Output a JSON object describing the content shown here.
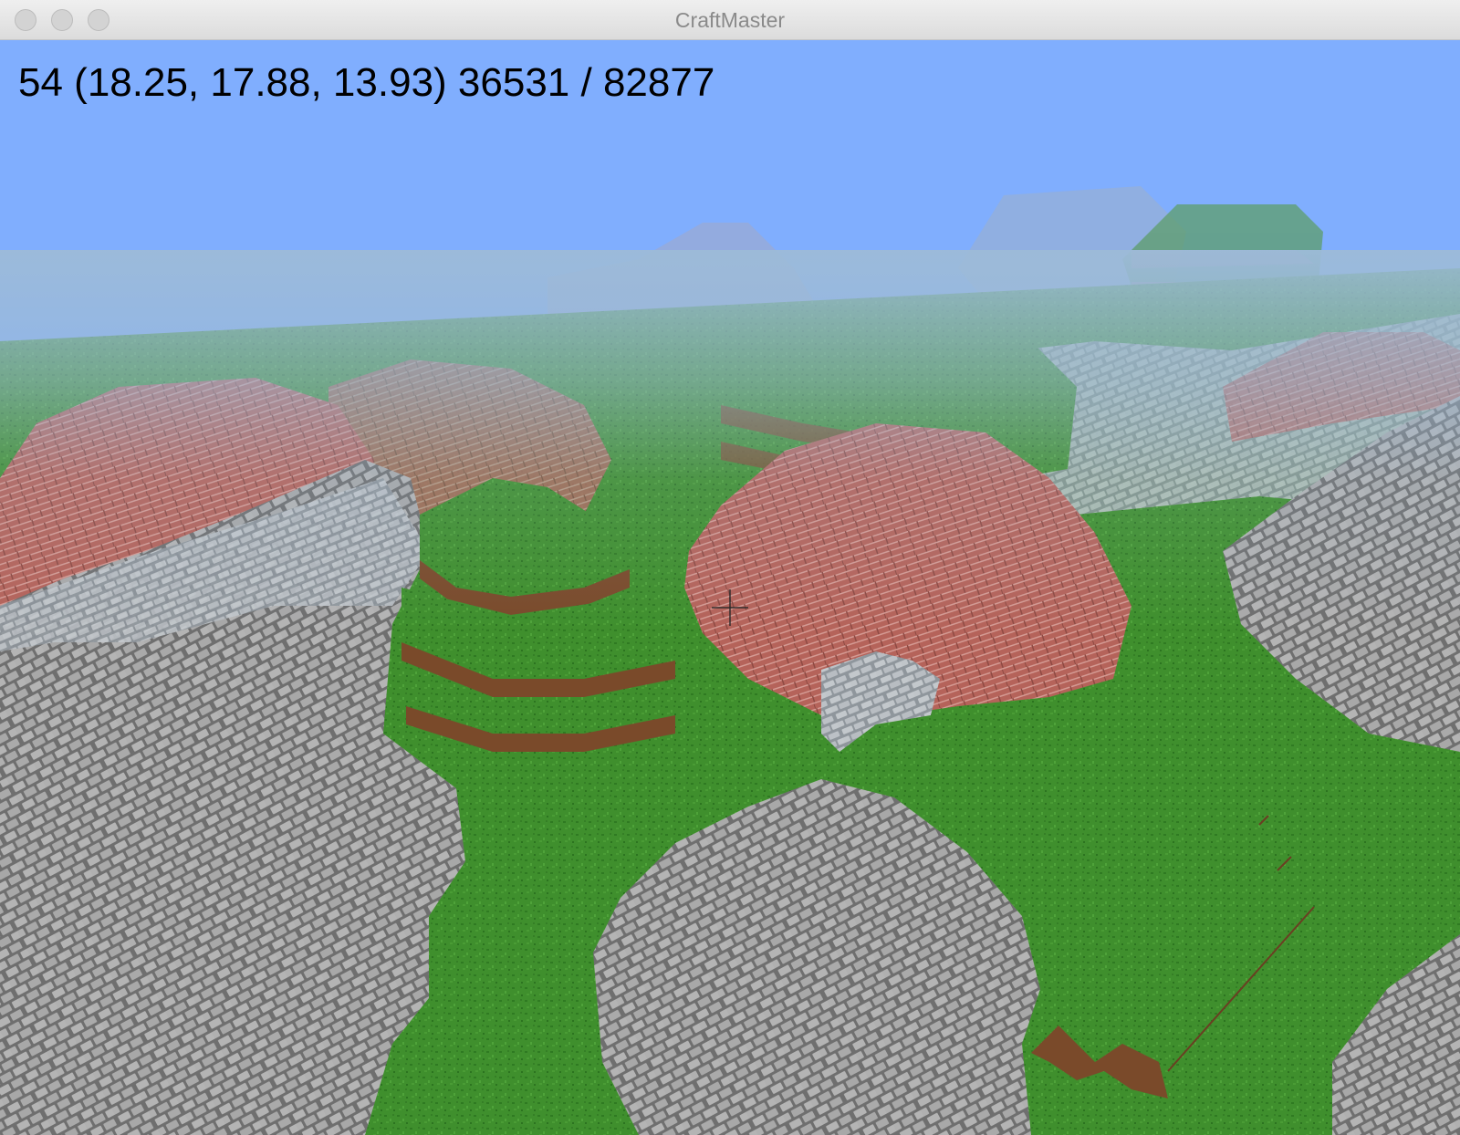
{
  "window": {
    "title": "CraftMaster",
    "buttons": [
      "close-button",
      "minimize-button",
      "zoom-button"
    ]
  },
  "hud": {
    "text": "54 (18.25, 17.88, 13.93) 36531 / 82877"
  },
  "colors": {
    "sky": "#80aefe",
    "fog": "#9bbbd6",
    "grass": "#3e8f2c",
    "brick": "#b05e56",
    "stone": "#a5a5a5",
    "dirt": "#7a4a2a"
  }
}
